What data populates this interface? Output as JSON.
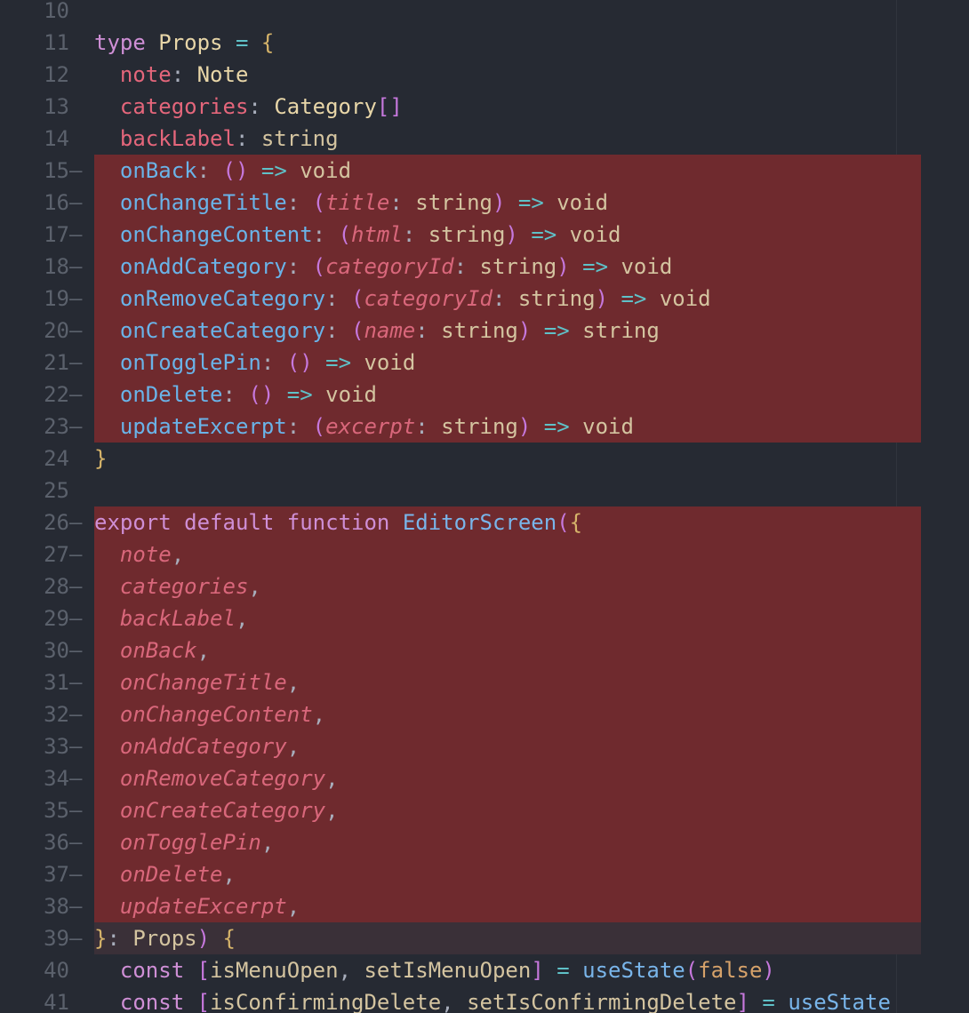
{
  "editor": {
    "lines": [
      {
        "n": "10",
        "changed": false,
        "hl": null,
        "tokens": []
      },
      {
        "n": "11",
        "changed": false,
        "hl": null,
        "tokens": [
          [
            "kw",
            "type"
          ],
          [
            "plain",
            " "
          ],
          [
            "type",
            "Props"
          ],
          [
            "plain",
            " "
          ],
          [
            "op",
            "="
          ],
          [
            "plain",
            " "
          ],
          [
            "brace",
            "{"
          ]
        ]
      },
      {
        "n": "12",
        "changed": false,
        "hl": null,
        "tokens": [
          [
            "plain",
            "  "
          ],
          [
            "prop",
            "note"
          ],
          [
            "punc",
            ": "
          ],
          [
            "type",
            "Note"
          ]
        ]
      },
      {
        "n": "13",
        "changed": false,
        "hl": null,
        "tokens": [
          [
            "plain",
            "  "
          ],
          [
            "prop",
            "categories"
          ],
          [
            "punc",
            ": "
          ],
          [
            "type",
            "Category"
          ],
          [
            "paren",
            "[]"
          ]
        ]
      },
      {
        "n": "14",
        "changed": false,
        "hl": null,
        "tokens": [
          [
            "plain",
            "  "
          ],
          [
            "prop",
            "backLabel"
          ],
          [
            "punc",
            ": "
          ],
          [
            "plain",
            "string"
          ]
        ]
      },
      {
        "n": "15",
        "changed": true,
        "hl": "red",
        "tokens": [
          [
            "plain",
            "  "
          ],
          [
            "fnprop",
            "onBack"
          ],
          [
            "punc",
            ": "
          ],
          [
            "paren",
            "()"
          ],
          [
            "plain",
            " "
          ],
          [
            "op",
            "=>"
          ],
          [
            "plain",
            " void"
          ]
        ]
      },
      {
        "n": "16",
        "changed": true,
        "hl": "red",
        "tokens": [
          [
            "plain",
            "  "
          ],
          [
            "fnprop",
            "onChangeTitle"
          ],
          [
            "punc",
            ": "
          ],
          [
            "paren",
            "("
          ],
          [
            "param",
            "title"
          ],
          [
            "punc",
            ": "
          ],
          [
            "plain",
            "string"
          ],
          [
            "paren",
            ")"
          ],
          [
            "plain",
            " "
          ],
          [
            "op",
            "=>"
          ],
          [
            "plain",
            " void"
          ]
        ]
      },
      {
        "n": "17",
        "changed": true,
        "hl": "red",
        "tokens": [
          [
            "plain",
            "  "
          ],
          [
            "fnprop",
            "onChangeContent"
          ],
          [
            "punc",
            ": "
          ],
          [
            "paren",
            "("
          ],
          [
            "param",
            "html"
          ],
          [
            "punc",
            ": "
          ],
          [
            "plain",
            "string"
          ],
          [
            "paren",
            ")"
          ],
          [
            "plain",
            " "
          ],
          [
            "op",
            "=>"
          ],
          [
            "plain",
            " void"
          ]
        ]
      },
      {
        "n": "18",
        "changed": true,
        "hl": "red",
        "tokens": [
          [
            "plain",
            "  "
          ],
          [
            "fnprop",
            "onAddCategory"
          ],
          [
            "punc",
            ": "
          ],
          [
            "paren",
            "("
          ],
          [
            "param",
            "categoryId"
          ],
          [
            "punc",
            ": "
          ],
          [
            "plain",
            "string"
          ],
          [
            "paren",
            ")"
          ],
          [
            "plain",
            " "
          ],
          [
            "op",
            "=>"
          ],
          [
            "plain",
            " void"
          ]
        ]
      },
      {
        "n": "19",
        "changed": true,
        "hl": "red",
        "tokens": [
          [
            "plain",
            "  "
          ],
          [
            "fnprop",
            "onRemoveCategory"
          ],
          [
            "punc",
            ": "
          ],
          [
            "paren",
            "("
          ],
          [
            "param",
            "categoryId"
          ],
          [
            "punc",
            ": "
          ],
          [
            "plain",
            "string"
          ],
          [
            "paren",
            ")"
          ],
          [
            "plain",
            " "
          ],
          [
            "op",
            "=>"
          ],
          [
            "plain",
            " void"
          ]
        ]
      },
      {
        "n": "20",
        "changed": true,
        "hl": "red",
        "tokens": [
          [
            "plain",
            "  "
          ],
          [
            "fnprop",
            "onCreateCategory"
          ],
          [
            "punc",
            ": "
          ],
          [
            "paren",
            "("
          ],
          [
            "param",
            "name"
          ],
          [
            "punc",
            ": "
          ],
          [
            "plain",
            "string"
          ],
          [
            "paren",
            ")"
          ],
          [
            "plain",
            " "
          ],
          [
            "op",
            "=>"
          ],
          [
            "plain",
            " string"
          ]
        ]
      },
      {
        "n": "21",
        "changed": true,
        "hl": "red",
        "tokens": [
          [
            "plain",
            "  "
          ],
          [
            "fnprop",
            "onTogglePin"
          ],
          [
            "punc",
            ": "
          ],
          [
            "paren",
            "()"
          ],
          [
            "plain",
            " "
          ],
          [
            "op",
            "=>"
          ],
          [
            "plain",
            " void"
          ]
        ]
      },
      {
        "n": "22",
        "changed": true,
        "hl": "red",
        "tokens": [
          [
            "plain",
            "  "
          ],
          [
            "fnprop",
            "onDelete"
          ],
          [
            "punc",
            ": "
          ],
          [
            "paren",
            "()"
          ],
          [
            "plain",
            " "
          ],
          [
            "op",
            "=>"
          ],
          [
            "plain",
            " void"
          ]
        ]
      },
      {
        "n": "23",
        "changed": true,
        "hl": "red",
        "tokens": [
          [
            "plain",
            "  "
          ],
          [
            "fnprop",
            "updateExcerpt"
          ],
          [
            "punc",
            ": "
          ],
          [
            "paren",
            "("
          ],
          [
            "param",
            "excerpt"
          ],
          [
            "punc",
            ": "
          ],
          [
            "plain",
            "string"
          ],
          [
            "paren",
            ")"
          ],
          [
            "plain",
            " "
          ],
          [
            "op",
            "=>"
          ],
          [
            "plain",
            " void"
          ]
        ]
      },
      {
        "n": "24",
        "changed": false,
        "hl": null,
        "tokens": [
          [
            "brace",
            "}"
          ]
        ]
      },
      {
        "n": "25",
        "changed": false,
        "hl": null,
        "tokens": []
      },
      {
        "n": "26",
        "changed": true,
        "hl": "red",
        "tokens": [
          [
            "kw",
            "export"
          ],
          [
            "plain",
            " "
          ],
          [
            "kw",
            "default"
          ],
          [
            "plain",
            " "
          ],
          [
            "kw",
            "function"
          ],
          [
            "plain",
            " "
          ],
          [
            "fn",
            "EditorScreen"
          ],
          [
            "paren",
            "("
          ],
          [
            "brace",
            "{"
          ]
        ]
      },
      {
        "n": "27",
        "changed": true,
        "hl": "red",
        "tokens": [
          [
            "plain",
            "  "
          ],
          [
            "param",
            "note"
          ],
          [
            "punc",
            ","
          ]
        ]
      },
      {
        "n": "28",
        "changed": true,
        "hl": "red",
        "tokens": [
          [
            "plain",
            "  "
          ],
          [
            "param",
            "categories"
          ],
          [
            "punc",
            ","
          ]
        ]
      },
      {
        "n": "29",
        "changed": true,
        "hl": "red",
        "tokens": [
          [
            "plain",
            "  "
          ],
          [
            "param",
            "backLabel"
          ],
          [
            "punc",
            ","
          ]
        ]
      },
      {
        "n": "30",
        "changed": true,
        "hl": "red",
        "tokens": [
          [
            "plain",
            "  "
          ],
          [
            "param",
            "onBack"
          ],
          [
            "punc",
            ","
          ]
        ]
      },
      {
        "n": "31",
        "changed": true,
        "hl": "red",
        "tokens": [
          [
            "plain",
            "  "
          ],
          [
            "param",
            "onChangeTitle"
          ],
          [
            "punc",
            ","
          ]
        ]
      },
      {
        "n": "32",
        "changed": true,
        "hl": "red",
        "tokens": [
          [
            "plain",
            "  "
          ],
          [
            "param",
            "onChangeContent"
          ],
          [
            "punc",
            ","
          ]
        ]
      },
      {
        "n": "33",
        "changed": true,
        "hl": "red",
        "tokens": [
          [
            "plain",
            "  "
          ],
          [
            "param",
            "onAddCategory"
          ],
          [
            "punc",
            ","
          ]
        ]
      },
      {
        "n": "34",
        "changed": true,
        "hl": "red",
        "tokens": [
          [
            "plain",
            "  "
          ],
          [
            "param",
            "onRemoveCategory"
          ],
          [
            "punc",
            ","
          ]
        ]
      },
      {
        "n": "35",
        "changed": true,
        "hl": "red",
        "tokens": [
          [
            "plain",
            "  "
          ],
          [
            "param",
            "onCreateCategory"
          ],
          [
            "punc",
            ","
          ]
        ]
      },
      {
        "n": "36",
        "changed": true,
        "hl": "red",
        "tokens": [
          [
            "plain",
            "  "
          ],
          [
            "param",
            "onTogglePin"
          ],
          [
            "punc",
            ","
          ]
        ]
      },
      {
        "n": "37",
        "changed": true,
        "hl": "red",
        "tokens": [
          [
            "plain",
            "  "
          ],
          [
            "param",
            "onDelete"
          ],
          [
            "punc",
            ","
          ]
        ]
      },
      {
        "n": "38",
        "changed": true,
        "hl": "red",
        "tokens": [
          [
            "plain",
            "  "
          ],
          [
            "param",
            "updateExcerpt"
          ],
          [
            "punc",
            ","
          ]
        ]
      },
      {
        "n": "39",
        "changed": true,
        "hl": "dim",
        "tokens": [
          [
            "brace",
            "}"
          ],
          [
            "punc",
            ": "
          ],
          [
            "plain",
            "Props"
          ],
          [
            "paren",
            ")"
          ],
          [
            "plain",
            " "
          ],
          [
            "brace",
            "{"
          ]
        ]
      },
      {
        "n": "40",
        "changed": false,
        "hl": null,
        "tokens": [
          [
            "plain",
            "  "
          ],
          [
            "kw",
            "const"
          ],
          [
            "plain",
            " "
          ],
          [
            "paren",
            "["
          ],
          [
            "plain",
            "isMenuOpen"
          ],
          [
            "punc",
            ", "
          ],
          [
            "plain",
            "setIsMenuOpen"
          ],
          [
            "paren",
            "]"
          ],
          [
            "plain",
            " "
          ],
          [
            "op",
            "="
          ],
          [
            "plain",
            " "
          ],
          [
            "fn",
            "useState"
          ],
          [
            "paren",
            "("
          ],
          [
            "bool",
            "false"
          ],
          [
            "paren",
            ")"
          ]
        ]
      },
      {
        "n": "41",
        "changed": false,
        "hl": null,
        "tokens": [
          [
            "plain",
            "  "
          ],
          [
            "kw",
            "const"
          ],
          [
            "plain",
            " "
          ],
          [
            "paren",
            "["
          ],
          [
            "plain",
            "isConfirmingDelete"
          ],
          [
            "punc",
            ", "
          ],
          [
            "plain",
            "setIsConfirmingDelete"
          ],
          [
            "paren",
            "]"
          ],
          [
            "plain",
            " "
          ],
          [
            "op",
            "="
          ],
          [
            "plain",
            " "
          ],
          [
            "fn",
            "useState"
          ]
        ]
      }
    ]
  },
  "colors": {
    "background": "#262a33",
    "change_highlight": "#6f2a2e",
    "line_number": "#5b616c"
  }
}
